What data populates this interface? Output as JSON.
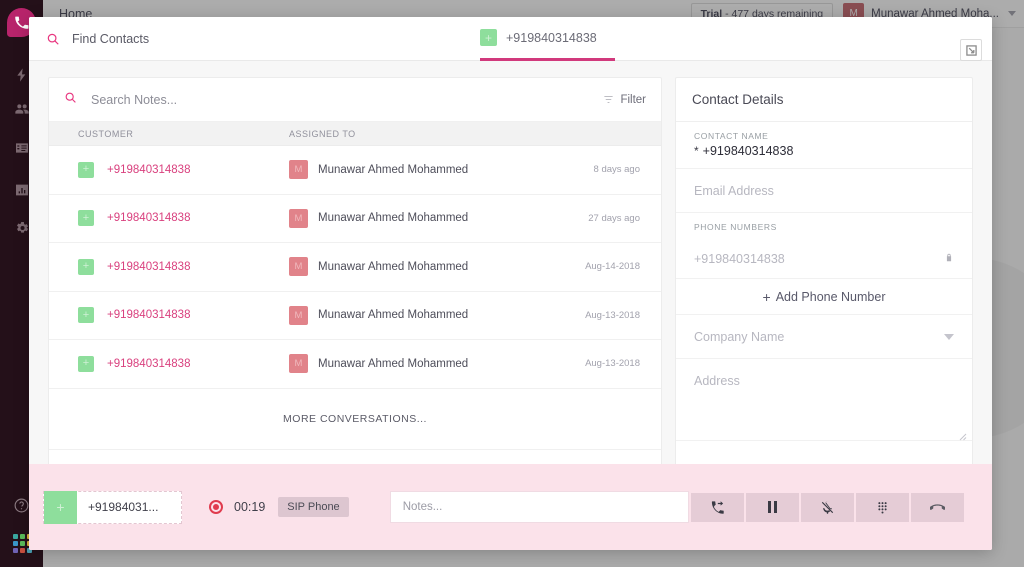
{
  "background": {
    "home_label": "Home",
    "trial_label_bold": "Trial",
    "trial_label_rest": " - 477 days remaining",
    "user_initial": "M",
    "user_name": "Munawar Ahmed Moha..."
  },
  "sidebar": {
    "items": [
      {
        "name": "logo",
        "icon": "phone-icon"
      },
      {
        "name": "activity",
        "icon": "lightning-icon"
      },
      {
        "name": "contacts",
        "icon": "people-icon"
      },
      {
        "name": "cards",
        "icon": "list-card-icon"
      },
      {
        "name": "reports",
        "icon": "bar-chart-icon"
      },
      {
        "name": "settings",
        "icon": "gear-icon"
      }
    ],
    "help_icon": "question-circle-icon",
    "apps_icon": "apps-grid-icon",
    "app_dot_colors": [
      "#3aa8a0",
      "#5bbd5b",
      "#d8b13a",
      "#3a97c9",
      "#6f63b5",
      "#c9503f",
      "#4aa0b5",
      "#5bbd5b",
      "#d8b13a"
    ]
  },
  "modal": {
    "find_contacts": "Find Contacts",
    "find_contacts_icon": "search-icon",
    "tab": {
      "badge": "+",
      "label": "+919840314838"
    },
    "expand_icon": "expand-icon"
  },
  "notes_panel": {
    "search_placeholder": "Search Notes...",
    "search_icon": "search-icon",
    "filter_label": "Filter",
    "filter_icon": "filter-icon",
    "columns": {
      "customer": "CUSTOMER",
      "assigned_to": "ASSIGNED TO"
    },
    "rows": [
      {
        "badge": "+",
        "customer": "+919840314838",
        "avatar": "M",
        "assigned_to": "Munawar Ahmed Mohammed",
        "time": "8 days ago"
      },
      {
        "badge": "+",
        "customer": "+919840314838",
        "avatar": "M",
        "assigned_to": "Munawar Ahmed Mohammed",
        "time": "27 days ago"
      },
      {
        "badge": "+",
        "customer": "+919840314838",
        "avatar": "M",
        "assigned_to": "Munawar Ahmed Mohammed",
        "time": "Aug-14-2018"
      },
      {
        "badge": "+",
        "customer": "+919840314838",
        "avatar": "M",
        "assigned_to": "Munawar Ahmed Mohammed",
        "time": "Aug-13-2018"
      },
      {
        "badge": "+",
        "customer": "+919840314838",
        "avatar": "M",
        "assigned_to": "Munawar Ahmed Mohammed",
        "time": "Aug-13-2018"
      }
    ],
    "more_conversations": "MORE CONVERSATIONS..."
  },
  "contact_details": {
    "title": "Contact Details",
    "contact_name_label": "CONTACT NAME",
    "contact_name_required": "*",
    "contact_name_value": "+919840314838",
    "email_placeholder": "Email Address",
    "phone_numbers_label": "PHONE NUMBERS",
    "phone_value": "+919840314838",
    "lock_icon": "lock-icon",
    "add_phone_label": "Add Phone Number",
    "add_phone_plus": "+",
    "company_placeholder": "Company Name",
    "company_caret_icon": "chevron-down-icon",
    "address_placeholder": "Address",
    "resize_icon": "resize-handle-icon"
  },
  "callbar": {
    "badge": "+",
    "number": "+91984031...",
    "recording_icon": "record-icon",
    "timer": "00:19",
    "sip_label": "SIP Phone",
    "notes_placeholder": "Notes...",
    "buttons": [
      {
        "name": "transfer-call-button",
        "icon": "transfer-call-icon"
      },
      {
        "name": "hold-button",
        "icon": "pause-icon"
      },
      {
        "name": "mute-button",
        "icon": "mic-muted-icon"
      },
      {
        "name": "keypad-button",
        "icon": "dialpad-icon"
      },
      {
        "name": "hangup-button",
        "icon": "hangup-icon"
      }
    ]
  }
}
